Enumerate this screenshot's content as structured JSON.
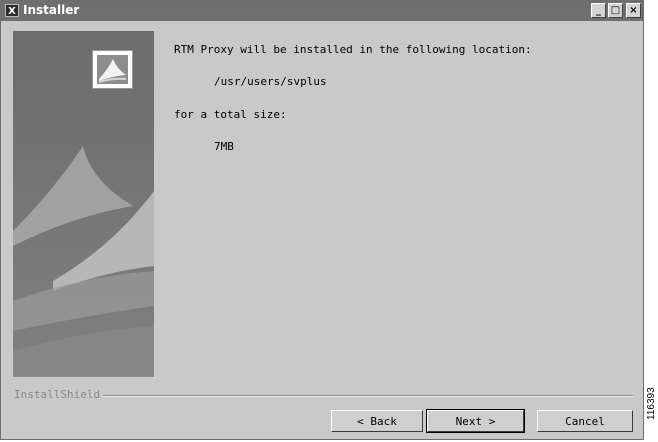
{
  "window": {
    "title": "Installer",
    "app_icon": "X"
  },
  "titlebar_buttons": {
    "minimize": "_",
    "maximize": "□",
    "close": "×"
  },
  "content": {
    "message": "RTM Proxy will be installed in the following location:",
    "path": "/usr/users/svplus",
    "size_label": "for a total size:",
    "size_value": "7MB"
  },
  "brand": {
    "label": "InstallShield"
  },
  "buttons": {
    "back": "< Back",
    "next": "Next >",
    "cancel": "Cancel"
  },
  "figure_id": "116393",
  "icons": {
    "side_image": "installshield-tent-graphic",
    "logo": "installshield-logo-icon"
  }
}
